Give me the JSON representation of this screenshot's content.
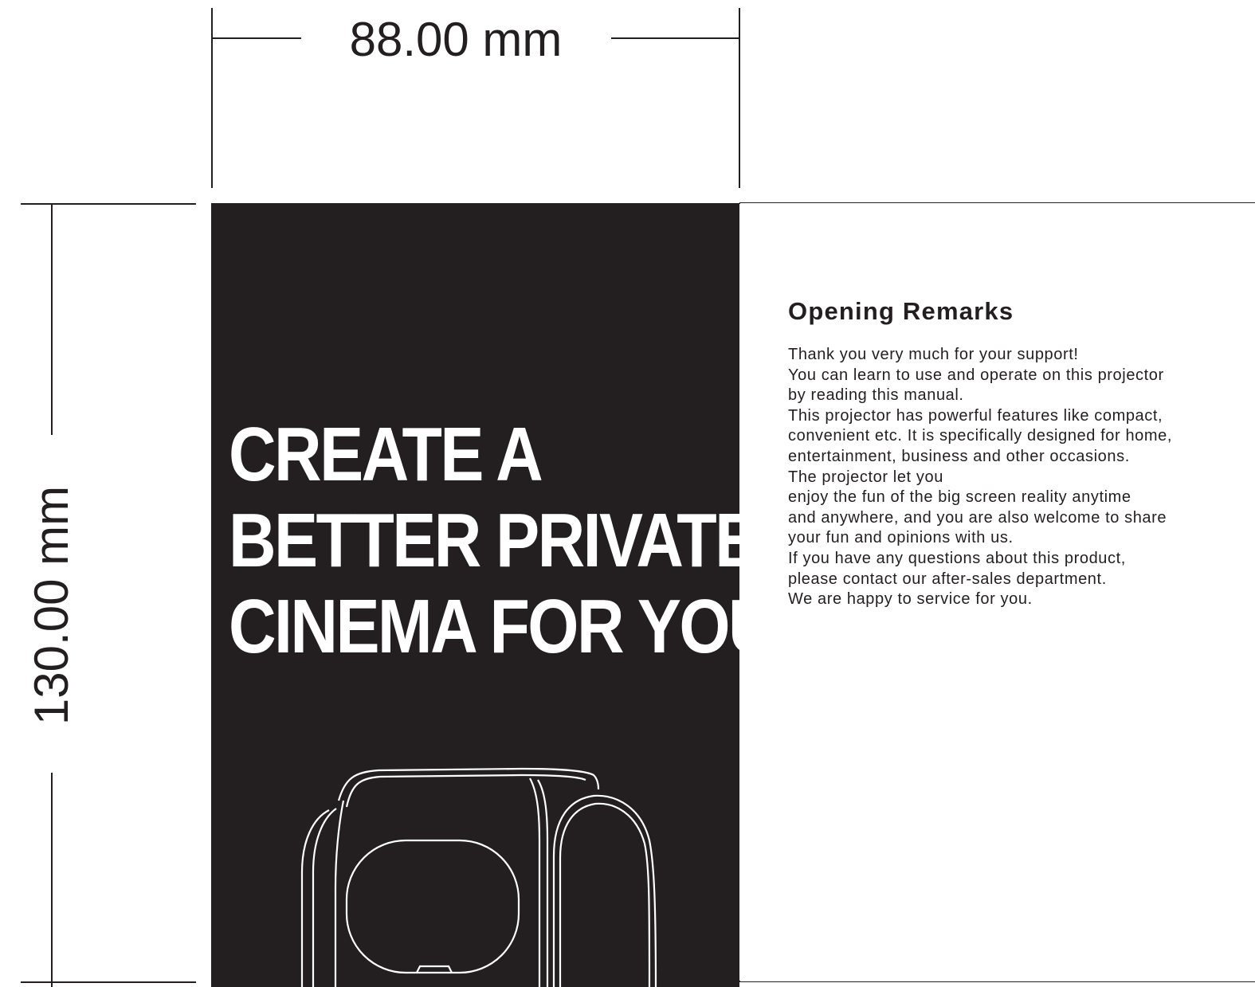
{
  "dimensions": {
    "width_label": "88.00 mm",
    "height_label": "130.00 mm"
  },
  "front_panel": {
    "headline_lines": [
      "CREATE A",
      "BETTER PRIVATE",
      "CINEMA FOR YOU"
    ],
    "illustration": "projector-line-drawing",
    "background_color": "#231f20",
    "text_color": "#ffffff"
  },
  "back_panel": {
    "title": "Opening Remarks",
    "body_lines": [
      "Thank you very much for your support!",
      "You can learn to use and operate on this projector",
      "by reading this manual.",
      "This projector has powerful features like compact,",
      "convenient etc. It is specifically designed for home,",
      "entertainment, business and other occasions.",
      "The projector let you",
      "enjoy the fun of the big screen reality anytime",
      "and anywhere, and you are also welcome to share",
      "your fun and opinions with us.",
      "If you have any questions about this product,",
      "please contact our after-sales department.",
      "We are happy to service for you."
    ]
  }
}
